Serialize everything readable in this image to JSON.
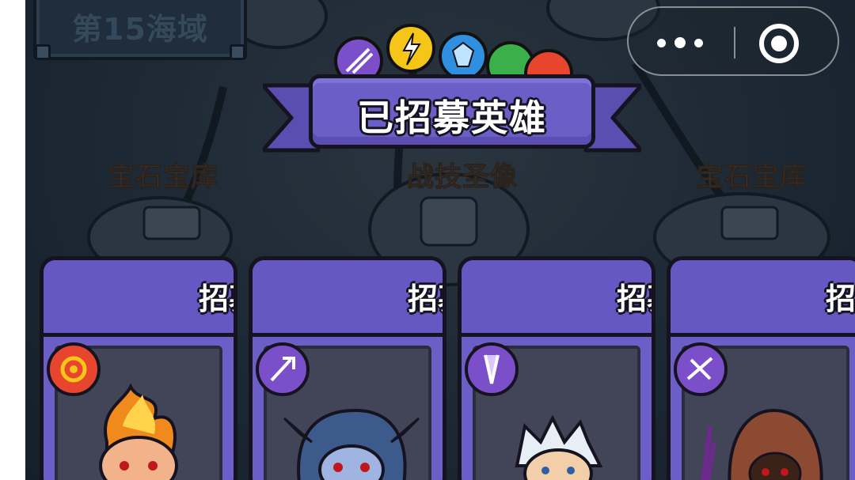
{
  "region": {
    "label": "第15海域"
  },
  "buildings": [
    {
      "id": "left",
      "label": "宝石宝库"
    },
    {
      "id": "center",
      "label": "战技圣像"
    },
    {
      "id": "right",
      "label": "宝石宝库"
    }
  ],
  "banner": {
    "title": "已招募英雄"
  },
  "gems": [
    "arcane-gem-icon",
    "lightning-gem-icon",
    "ice-gem-icon",
    "nature-gem-icon",
    "fire-gem-icon"
  ],
  "colors": {
    "banner": "#6b5fc7",
    "background": "#1b2733",
    "fire": "#e8452e",
    "lightning": "#f5c518",
    "ice": "#2f8fe0",
    "nature": "#3bb04a",
    "arcane": "#7b4fc9"
  },
  "cards": [
    {
      "recruit_label": "招募",
      "element_icon": "fire-element-icon",
      "hero": "flame-hero"
    },
    {
      "recruit_label": "招募",
      "element_icon": "spear-element-icon",
      "hero": "hooded-elf-hero"
    },
    {
      "recruit_label": "招募",
      "element_icon": "blade-element-icon",
      "hero": "white-haired-hero"
    },
    {
      "recruit_label": "招募",
      "element_icon": "crossbow-element-icon",
      "hero": "brown-hood-hero"
    }
  ],
  "system": {
    "more_icon": "more-dots-icon",
    "close_icon": "close-target-icon"
  }
}
